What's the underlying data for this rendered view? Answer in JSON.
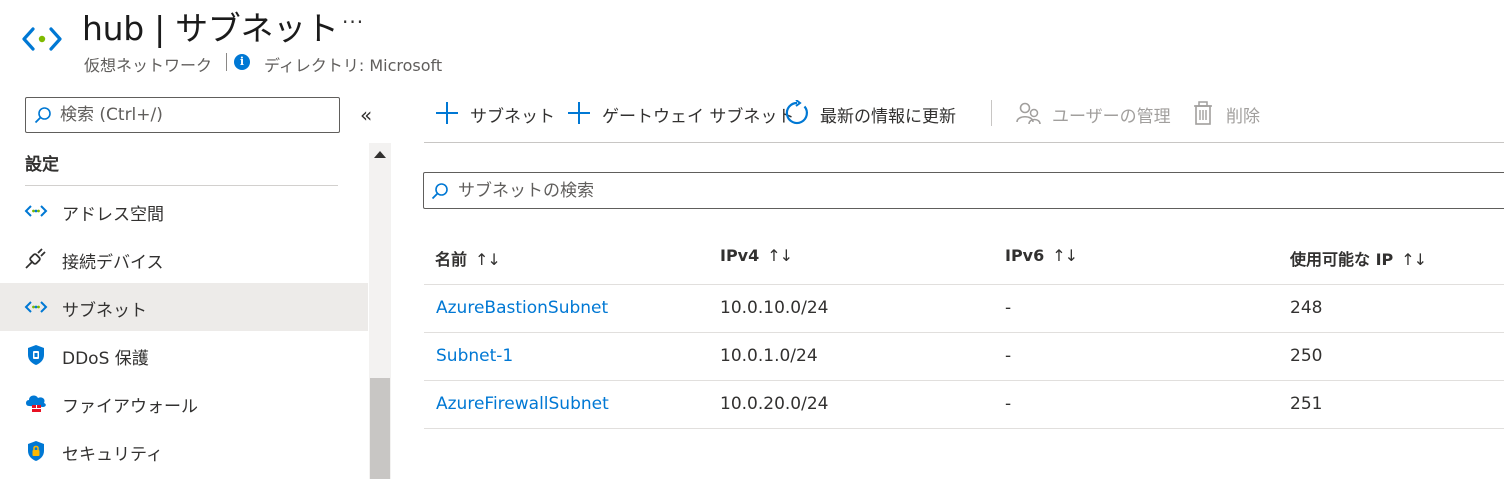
{
  "header": {
    "title": "hub | サブネット",
    "more": "···",
    "subtitle": "仮想ネットワーク",
    "directory": "ディレクトリ: Microsoft"
  },
  "sidebar": {
    "search_placeholder": "検索 (Ctrl+/)",
    "collapse": "«",
    "section": "設定",
    "items": [
      {
        "label": "アドレス空間",
        "icon": "vnet-icon"
      },
      {
        "label": "接続デバイス",
        "icon": "plug-icon"
      },
      {
        "label": "サブネット",
        "icon": "vnet-icon",
        "selected": true
      },
      {
        "label": "DDoS 保護",
        "icon": "shield-icon"
      },
      {
        "label": "ファイアウォール",
        "icon": "firewall-icon"
      },
      {
        "label": "セキュリティ",
        "icon": "security-lock-icon"
      }
    ]
  },
  "toolbar": {
    "add_subnet": "サブネット",
    "add_gateway_subnet": "ゲートウェイ サブネット",
    "refresh": "最新の情報に更新",
    "manage_users": "ユーザーの管理",
    "delete": "削除"
  },
  "search": {
    "placeholder": "サブネットの検索"
  },
  "table": {
    "columns": [
      "名前",
      "IPv4",
      "IPv6",
      "使用可能な IP"
    ],
    "sort_glyph": "↑↓",
    "rows": [
      {
        "name": "AzureBastionSubnet",
        "ipv4": "10.0.10.0/24",
        "ipv6": "-",
        "available_ips": "248"
      },
      {
        "name": "Subnet-1",
        "ipv4": "10.0.1.0/24",
        "ipv6": "-",
        "available_ips": "250"
      },
      {
        "name": "AzureFirewallSubnet",
        "ipv4": "10.0.20.0/24",
        "ipv6": "-",
        "available_ips": "251"
      }
    ]
  },
  "colors": {
    "accent": "#0078d4",
    "vnet_green": "#7fba00",
    "selected_bg": "#edebe9"
  }
}
